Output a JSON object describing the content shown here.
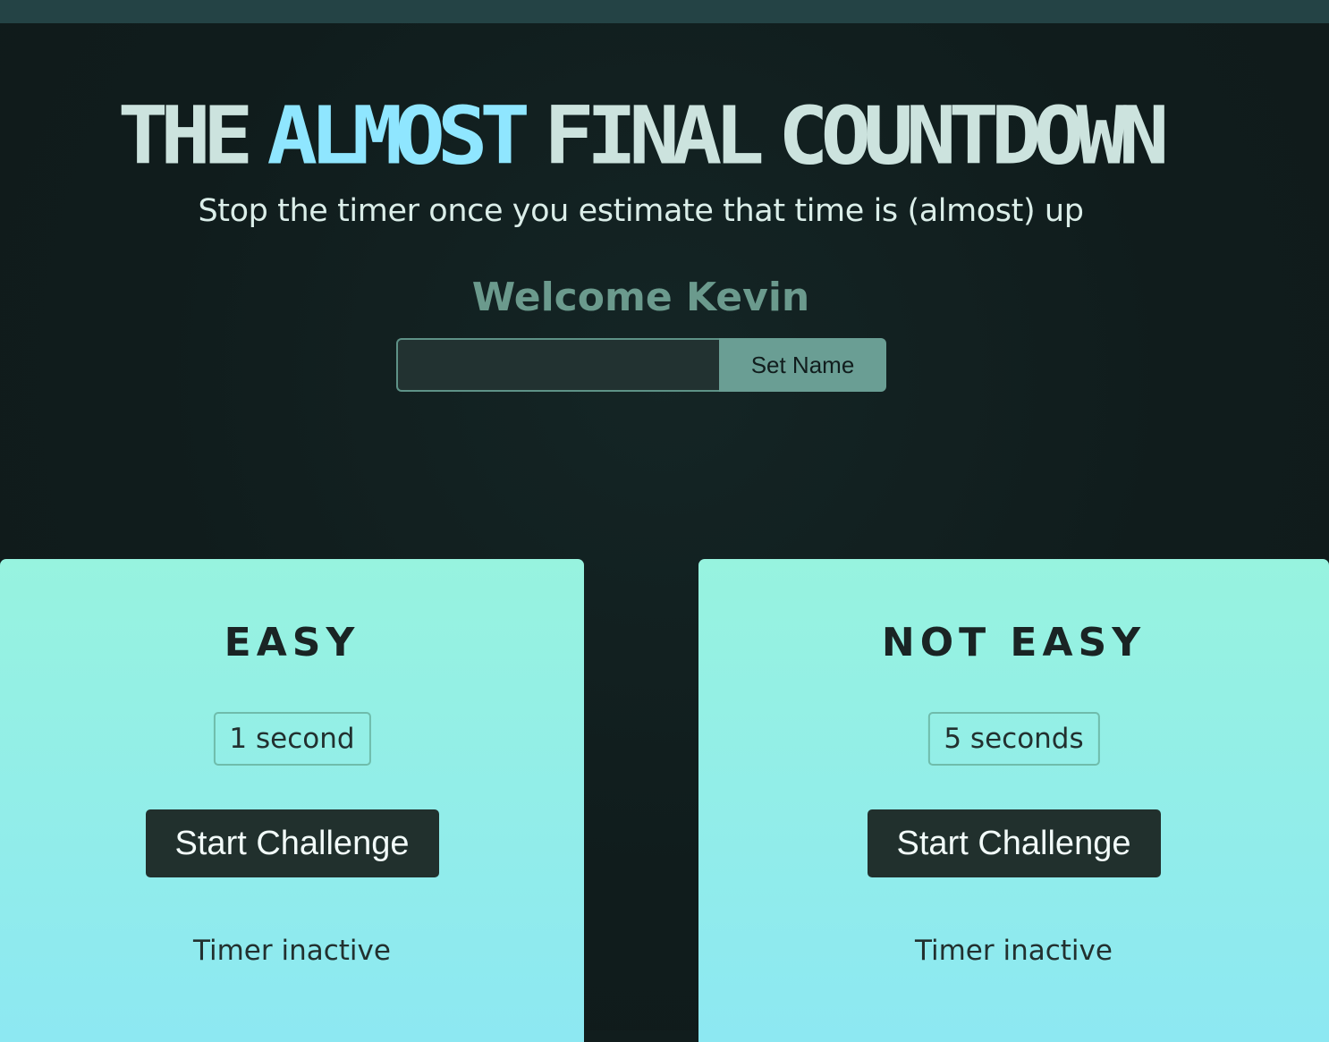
{
  "header": {
    "title_words": [
      "THE",
      "ALMOST",
      "FINAL",
      "COUNTDOWN"
    ],
    "subtitle": "Stop the timer once you estimate that time is (almost) up",
    "welcome": "Welcome Kevin"
  },
  "name_form": {
    "input_value": "",
    "set_name_label": "Set Name"
  },
  "challenges": [
    {
      "title": "EASY",
      "duration": "1 second",
      "start_label": "Start Challenge",
      "status": "Timer inactive"
    },
    {
      "title": "NOT EASY",
      "duration": "5 seconds",
      "start_label": "Start Challenge",
      "status": "Timer inactive"
    }
  ],
  "colors": {
    "background": "#111d1d",
    "title": "#cce3de",
    "title_accent": "#8fe6ff",
    "welcome": "#6b9a8d",
    "card_gradient_top": "#97f3df",
    "card_gradient_bottom": "#8de8f2",
    "button": "#21302d"
  }
}
